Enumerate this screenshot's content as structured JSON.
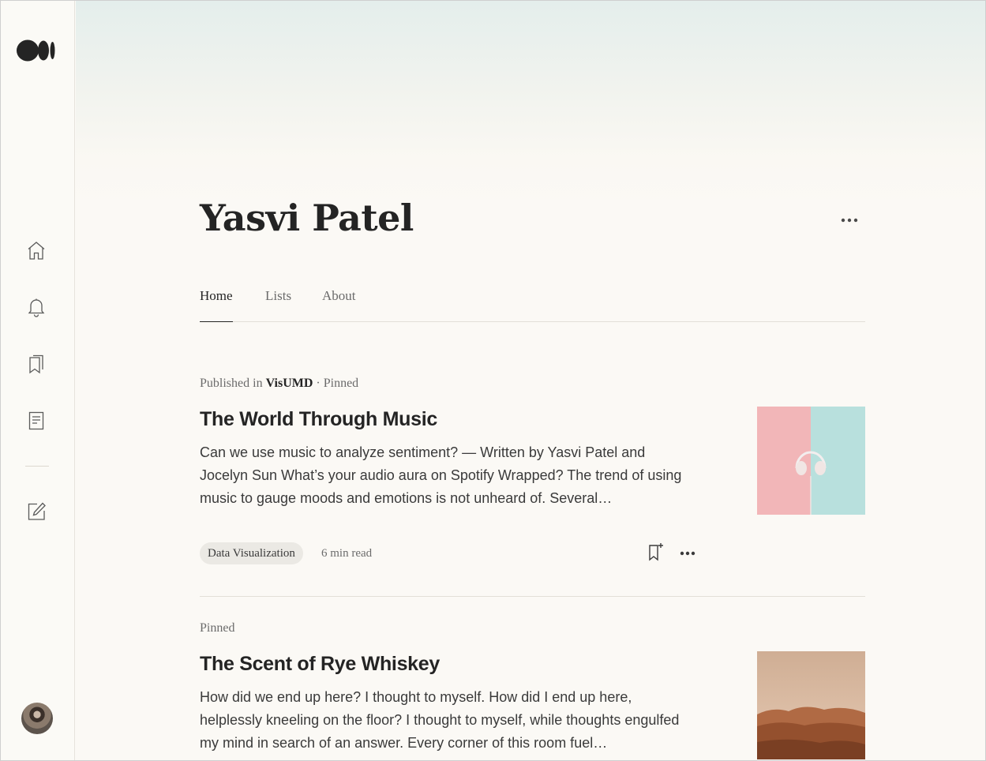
{
  "profile": {
    "name": "Yasvi Patel"
  },
  "tabs": [
    {
      "label": "Home",
      "active": true
    },
    {
      "label": "Lists",
      "active": false
    },
    {
      "label": "About",
      "active": false
    }
  ],
  "sidebar": {
    "items": [
      {
        "icon": "home-icon"
      },
      {
        "icon": "bell-icon"
      },
      {
        "icon": "bookmarks-icon"
      },
      {
        "icon": "stories-icon"
      },
      {
        "icon": "write-icon"
      }
    ]
  },
  "posts": [
    {
      "meta_prefix": "Published in",
      "publication": "VisUMD",
      "meta_suffix": "· Pinned",
      "title": "The World Through Music",
      "excerpt": "Can we use music to analyze sentiment? — Written by Yasvi Patel and Jocelyn Sun What’s your audio aura on Spotify Wrapped? The trend of using music to gauge moods and emotions is not unheard of. Several…",
      "tag": "Data Visualization",
      "read_time": "6 min read"
    },
    {
      "meta_prefix": "Pinned",
      "title": "The Scent of Rye Whiskey",
      "excerpt": "How did we end up here? I thought to myself. How did I end up here, helplessly kneeling on the floor? I thought to myself, while thoughts engulfed my mind in search of an answer. Every corner of this room fuel…"
    }
  ],
  "colors": {
    "text": "#242424",
    "muted": "#6b6b6b",
    "background": "#fbf9f5",
    "tag_bg": "#ebe9e4"
  }
}
